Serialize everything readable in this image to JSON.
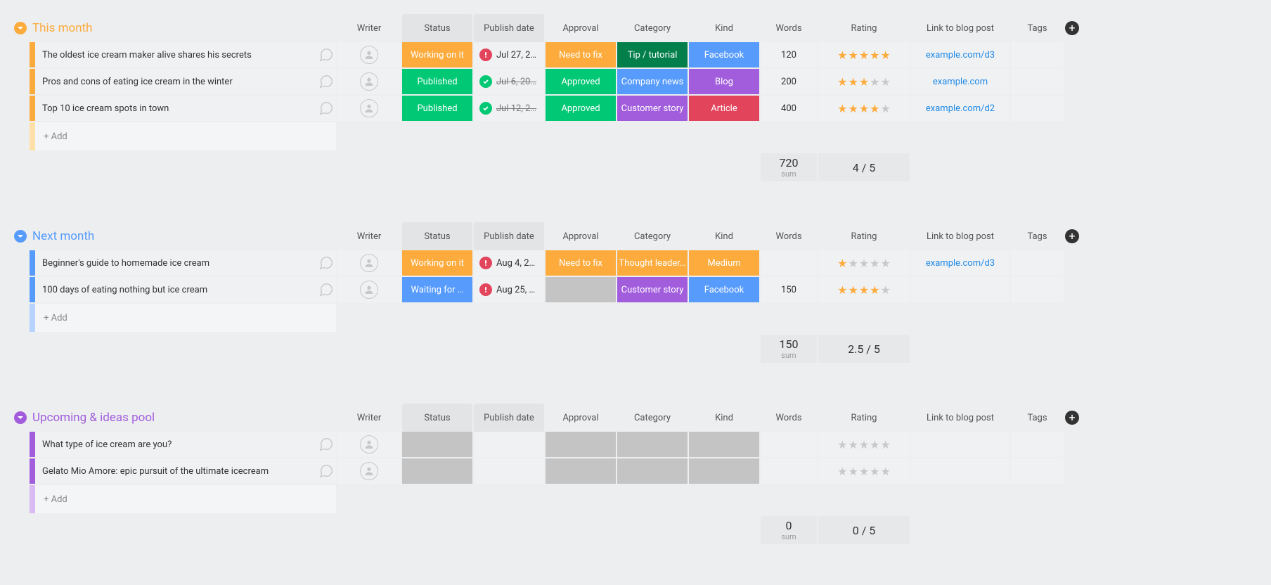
{
  "columns": {
    "writer": "Writer",
    "status": "Status",
    "publish_date": "Publish date",
    "approval": "Approval",
    "category": "Category",
    "kind": "Kind",
    "words": "Words",
    "rating": "Rating",
    "link": "Link to blog post",
    "tags": "Tags"
  },
  "add_label": "+ Add",
  "sum_label": "sum",
  "rating_divider": " / 5",
  "colors": {
    "status_working": "#fdab3d",
    "status_published": "#00c875",
    "status_waiting": "#579bfc",
    "approval_needfix": "#fdab3d",
    "approval_approved": "#00c875",
    "cat_tip": "#037f4c",
    "cat_company": "#579bfc",
    "cat_customer": "#a25ddc",
    "cat_thought": "#fdab3d",
    "kind_facebook": "#579bfc",
    "kind_blog": "#a25ddc",
    "kind_article": "#e2445c",
    "kind_medium": "#fdab3d",
    "date_warn": "#e2445c",
    "date_ok": "#00c875",
    "empty_gray": "#c4c4c4"
  },
  "groups": [
    {
      "id": "this_month",
      "title": "This month",
      "color": "#fdab3d",
      "light": "#ffe0a8",
      "sum_words": "720",
      "sum_rating": "4",
      "rows": [
        {
          "title": "The oldest ice cream maker alive shares his secrets",
          "status": {
            "label": "Working on it",
            "color": "status_working"
          },
          "date": {
            "text": "Jul 27, 2…",
            "dot": "warn",
            "struck": false
          },
          "approval": {
            "label": "Need to fix",
            "color": "approval_needfix"
          },
          "category": {
            "label": "Tip / tutorial",
            "color": "cat_tip"
          },
          "kind": {
            "label": "Facebook",
            "color": "kind_facebook"
          },
          "words": "120",
          "rating": 5,
          "link": "example.com/d3"
        },
        {
          "title": "Pros and cons of eating ice cream in the winter",
          "status": {
            "label": "Published",
            "color": "status_published"
          },
          "date": {
            "text": "Jul 6, 20…",
            "dot": "ok",
            "struck": true
          },
          "approval": {
            "label": "Approved",
            "color": "approval_approved"
          },
          "category": {
            "label": "Company news",
            "color": "cat_company"
          },
          "kind": {
            "label": "Blog",
            "color": "kind_blog"
          },
          "words": "200",
          "rating": 3,
          "link": "example.com"
        },
        {
          "title": "Top 10 ice cream spots in town",
          "status": {
            "label": "Published",
            "color": "status_published"
          },
          "date": {
            "text": "Jul 12, 2…",
            "dot": "ok",
            "struck": true
          },
          "approval": {
            "label": "Approved",
            "color": "approval_approved"
          },
          "category": {
            "label": "Customer story",
            "color": "cat_customer"
          },
          "kind": {
            "label": "Article",
            "color": "kind_article"
          },
          "words": "400",
          "rating": 4,
          "link": "example.com/d2"
        }
      ]
    },
    {
      "id": "next_month",
      "title": "Next month",
      "color": "#579bfc",
      "light": "#b7d3ff",
      "sum_words": "150",
      "sum_rating": "2.5",
      "rows": [
        {
          "title": "Beginner's guide to homemade ice cream",
          "status": {
            "label": "Working on it",
            "color": "status_working"
          },
          "date": {
            "text": "Aug 4, 2…",
            "dot": "warn",
            "struck": false
          },
          "approval": {
            "label": "Need to fix",
            "color": "approval_needfix"
          },
          "category": {
            "label": "Thought leader…",
            "color": "cat_thought"
          },
          "kind": {
            "label": "Medium",
            "color": "kind_medium"
          },
          "words": "",
          "rating": 1,
          "link": "example.com/d3"
        },
        {
          "title": "100 days of eating nothing but ice cream",
          "status": {
            "label": "Waiting for …",
            "color": "status_waiting"
          },
          "date": {
            "text": "Aug 25, …",
            "dot": "warn",
            "struck": false
          },
          "approval": {
            "label": "",
            "color": "empty_gray"
          },
          "category": {
            "label": "Customer story",
            "color": "cat_customer"
          },
          "kind": {
            "label": "Facebook",
            "color": "kind_facebook"
          },
          "words": "150",
          "rating": 4,
          "link": ""
        }
      ]
    },
    {
      "id": "upcoming",
      "title": "Upcoming & ideas pool",
      "color": "#a25ddc",
      "light": "#d9baf3",
      "sum_words": "0",
      "sum_rating": "0",
      "rows": [
        {
          "title": "What type of ice cream are you?",
          "status": {
            "label": "",
            "color": "empty_gray"
          },
          "date": {
            "text": "",
            "dot": "",
            "struck": false
          },
          "approval": {
            "label": "",
            "color": "empty_gray"
          },
          "category": {
            "label": "",
            "color": "empty_gray"
          },
          "kind": {
            "label": "",
            "color": "empty_gray"
          },
          "words": "",
          "rating": 0,
          "link": ""
        },
        {
          "title": "Gelato Mio Amore: epic pursuit of the ultimate icecream",
          "status": {
            "label": "",
            "color": "empty_gray"
          },
          "date": {
            "text": "",
            "dot": "",
            "struck": false
          },
          "approval": {
            "label": "",
            "color": "empty_gray"
          },
          "category": {
            "label": "",
            "color": "empty_gray"
          },
          "kind": {
            "label": "",
            "color": "empty_gray"
          },
          "words": "",
          "rating": 0,
          "link": ""
        }
      ]
    }
  ]
}
